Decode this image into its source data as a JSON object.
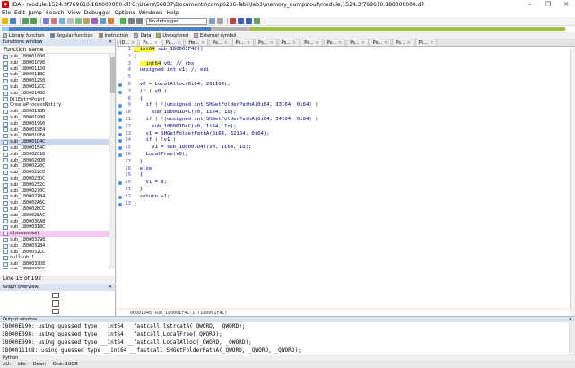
{
  "window": {
    "title": "IDA - module.1524.3f769610.180000000.dll C:\\Users\\56837\\Documents\\comp6236-labs\\lab3\\memory_dumps\\out\\module.1524.3f769610.180000000.dll",
    "minimize": "–",
    "maximize": "❐",
    "close": "✕"
  },
  "menu": [
    "File",
    "Edit",
    "Jump",
    "Search",
    "View",
    "Debugger",
    "Options",
    "Windows",
    "Help"
  ],
  "toolbar": {
    "debugger_select": "No debugger"
  },
  "legend": [
    {
      "label": "Library function",
      "color": "#8fd0e8"
    },
    {
      "label": "Regular function",
      "color": "#4f7fc0"
    },
    {
      "label": "Instruction",
      "color": "#b07050"
    },
    {
      "label": "Data",
      "color": "#b0b0b0"
    },
    {
      "label": "Unexplored",
      "color": "#a0c040"
    },
    {
      "label": "External symbol",
      "color": "#f0a0f0"
    }
  ],
  "functions_window": {
    "title": "Functions window",
    "column_header": "Function name",
    "items": [
      "sub_180001000",
      "sub_180001090",
      "sub_180001120",
      "sub_1800011BC",
      "sub_180001250",
      "sub_1800012CC",
      "sub_1800014B8",
      "DllEntryPoint",
      "CreateProcessNotify",
      "sub_1800017BD",
      "sub_180001900",
      "sub_180001960",
      "sub_1800019E4",
      "sub_180001CF4",
      "sub_180001D4C",
      "sub_180001F4C",
      "sub_180002018",
      "sub_1800020D8",
      "sub_18000220C",
      "sub_1800022C0",
      "sub_1800023DC",
      "sub_18000252C",
      "sub_18000270C",
      "sub_1800027B4",
      "sub_180002A6C",
      "sub_180002BCC",
      "sub_180002EAC",
      "sub_1800030A8",
      "sub_18000318C",
      "closesocket",
      "sub_180003298",
      "sub_1800032B4",
      "sub_1800032CC",
      "nullsub_1",
      "sub_1800033D8",
      "sub_1800033CC",
      "sub_1800034A8"
    ],
    "status": "Line 15 of 192"
  },
  "graph_overview": {
    "title": "Graph overview"
  },
  "tabs": [
    {
      "label": "ID..."
    },
    {
      "label": "Ps..."
    },
    {
      "label": "Ps..."
    },
    {
      "label": "He..."
    },
    {
      "label": "Ps..."
    },
    {
      "label": "Ps..."
    },
    {
      "label": "Ps..."
    },
    {
      "label": "Ps..."
    },
    {
      "label": "Ps..."
    },
    {
      "label": "Ps..."
    },
    {
      "label": "Ps..."
    },
    {
      "label": "Ps..."
    },
    {
      "label": "Ps..."
    },
    {
      "label": "Ps..."
    }
  ],
  "code_lines": [
    {
      "n": "1",
      "bp": false,
      "pre": "",
      "hl": "__int64",
      "post": " sub_180001F4C()"
    },
    {
      "n": "2",
      "bp": false,
      "pre": "{",
      "hl": "",
      "post": ""
    },
    {
      "n": "3",
      "bp": false,
      "pre": "  ",
      "hl": "__int64",
      "post": " v0; // rbx"
    },
    {
      "n": "4",
      "bp": false,
      "pre": "  unsigned int v1; // edi",
      "hl": "",
      "post": ""
    },
    {
      "n": "5",
      "bp": false,
      "pre": "",
      "hl": "",
      "post": ""
    },
    {
      "n": "6",
      "bp": true,
      "pre": "  v0 = LocalAlloc(0i64, 261164);",
      "hl": "",
      "post": ""
    },
    {
      "n": "7",
      "bp": true,
      "pre": "  if ( v0 )",
      "hl": "",
      "post": ""
    },
    {
      "n": "8",
      "bp": false,
      "pre": "  {",
      "hl": "",
      "post": ""
    },
    {
      "n": "9",
      "bp": true,
      "pre": "    if ( !(unsigned int)SHGetFolderPathA(0i64, 33164, 0i64) )",
      "hl": "",
      "post": ""
    },
    {
      "n": "10",
      "bp": true,
      "pre": "      sub_180001D4C(v0, 1i64, 1u);",
      "hl": "",
      "post": ""
    },
    {
      "n": "11",
      "bp": true,
      "pre": "    if ( !(unsigned int)SHGetFolderPathA(0i64, 34164, 0i64) )",
      "hl": "",
      "post": ""
    },
    {
      "n": "12",
      "bp": true,
      "pre": "      sub_180001D4C(v0, 1i64, 1u);",
      "hl": "",
      "post": ""
    },
    {
      "n": "13",
      "bp": true,
      "pre": "    v1 = SHGetFolderPathA(0i64, 32164, 0i64);",
      "hl": "",
      "post": ""
    },
    {
      "n": "14",
      "bp": true,
      "pre": "    if ( !v1 )",
      "hl": "",
      "post": ""
    },
    {
      "n": "15",
      "bp": true,
      "pre": "      v1 = sub_180001D4C(v0, 1i64, 1u);",
      "hl": "",
      "post": ""
    },
    {
      "n": "16",
      "bp": true,
      "pre": "    LocalFree(v0);",
      "hl": "",
      "post": ""
    },
    {
      "n": "17",
      "bp": false,
      "pre": "  }",
      "hl": "",
      "post": ""
    },
    {
      "n": "18",
      "bp": false,
      "pre": "  else",
      "hl": "",
      "post": ""
    },
    {
      "n": "19",
      "bp": false,
      "pre": "  {",
      "hl": "",
      "post": ""
    },
    {
      "n": "20",
      "bp": true,
      "pre": "    v1 = 8;",
      "hl": "",
      "post": ""
    },
    {
      "n": "21",
      "bp": false,
      "pre": "  }",
      "hl": "",
      "post": ""
    },
    {
      "n": "22",
      "bp": true,
      "pre": "  return v1;",
      "hl": "",
      "post": ""
    },
    {
      "n": "23",
      "bp": true,
      "pre": "}",
      "hl": "",
      "post": ""
    }
  ],
  "code_status": "00001346 sub_180001F4C:1 (180001F4C)",
  "output": {
    "title": "Output window",
    "lines": [
      "18000E190: using guessed type __int64 __fastcall lstrcatA(_QWORD, _QWORD);",
      "18000E098: using guessed type __int64 __fastcall LocalFree(_QWORD);",
      "18000E090: using guessed type __int64 __fastcall LocalAlloc(_QWORD, _QWORD);",
      "18000111C8: using guessed type __int64 __fastcall SHGetFolderPathA(_QWORD, _QWORD, _QWORD);"
    ],
    "language": "Python"
  },
  "statusbar": {
    "au": "AU:",
    "state": "idle",
    "direction": "Down",
    "disk": "Disk: 10GB"
  }
}
